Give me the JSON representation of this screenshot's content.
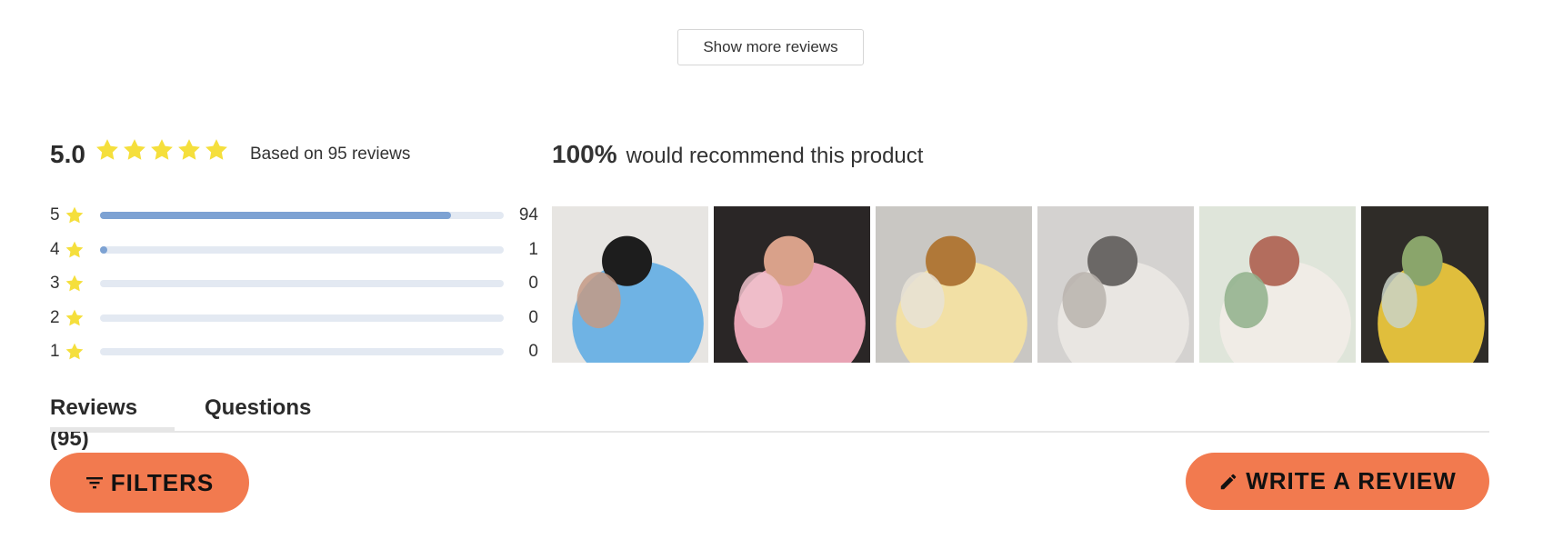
{
  "show_more": {
    "label": "Show more reviews"
  },
  "summary": {
    "average": "5.0",
    "star_count": 5,
    "based_on": "Based on 95 reviews",
    "star_color": "#f5df3c"
  },
  "distribution": [
    {
      "stars": "5",
      "count": "94",
      "fraction": 0.99
    },
    {
      "stars": "4",
      "count": "1",
      "fraction": 0.01
    },
    {
      "stars": "3",
      "count": "0",
      "fraction": 0
    },
    {
      "stars": "2",
      "count": "0",
      "fraction": 0
    },
    {
      "stars": "1",
      "count": "0",
      "fraction": 0
    }
  ],
  "recommend": {
    "percent": "100%",
    "text": "would recommend this product"
  },
  "photos": [
    {
      "name": "review-photo-1",
      "colors": [
        "#e7e5e2",
        "#6fb3e4",
        "#1d1d1d",
        "#c49a85"
      ]
    },
    {
      "name": "review-photo-2",
      "colors": [
        "#2a2626",
        "#e8a3b4",
        "#d9a18a",
        "#f0c2cc"
      ]
    },
    {
      "name": "review-photo-3",
      "colors": [
        "#c9c7c3",
        "#f2e0a5",
        "#b07838",
        "#e7e2d6"
      ]
    },
    {
      "name": "review-photo-4",
      "colors": [
        "#d4d2d0",
        "#e9e6e2",
        "#6b6866",
        "#b8b3ad"
      ]
    },
    {
      "name": "review-photo-5",
      "colors": [
        "#dfe5da",
        "#f0ece6",
        "#b36d5d",
        "#8fb08a"
      ]
    },
    {
      "name": "review-photo-6",
      "colors": [
        "#2f2c28",
        "#e0be3c",
        "#8aa56b",
        "#c9d3c7"
      ]
    }
  ],
  "tabs": [
    {
      "label": "Reviews (95)",
      "active": true
    },
    {
      "label": "Questions",
      "active": false
    }
  ],
  "buttons": {
    "filters": "FILTERS",
    "write_review": "WRITE A REVIEW"
  },
  "colors": {
    "accent": "#f27a4f",
    "bar_fill": "#7da2d3",
    "bar_track": "#e3e9f2"
  }
}
